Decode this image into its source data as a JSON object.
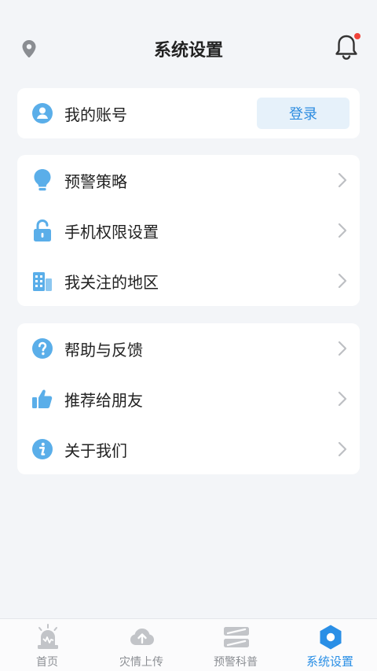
{
  "header": {
    "title": "系统设置",
    "location_icon": "location-pin-icon",
    "bell_icon": "bell-icon",
    "has_notification_dot": true
  },
  "account": {
    "label": "我的账号",
    "icon": "user-avatar-icon",
    "login_label": "登录"
  },
  "settings_group": [
    {
      "label": "预警策略",
      "icon": "lightbulb-icon"
    },
    {
      "label": "手机权限设置",
      "icon": "unlock-icon"
    },
    {
      "label": "我关注的地区",
      "icon": "buildings-icon"
    }
  ],
  "help_group": [
    {
      "label": "帮助与反馈",
      "icon": "question-icon"
    },
    {
      "label": "推荐给朋友",
      "icon": "thumbs-up-icon"
    },
    {
      "label": "关于我们",
      "icon": "info-icon"
    }
  ],
  "tabbar": [
    {
      "label": "首页",
      "icon": "alarm-siren-icon",
      "active": false
    },
    {
      "label": "灾情上传",
      "icon": "cloud-upload-icon",
      "active": false
    },
    {
      "label": "预警科普",
      "icon": "knowledge-stack-icon",
      "active": false
    },
    {
      "label": "系统设置",
      "icon": "settings-hex-icon",
      "active": true
    }
  ],
  "colors": {
    "accent": "#2a8fe6",
    "icon_blue": "#5aaee9",
    "badge_red": "#f0433a",
    "background": "#f3f5f8"
  }
}
